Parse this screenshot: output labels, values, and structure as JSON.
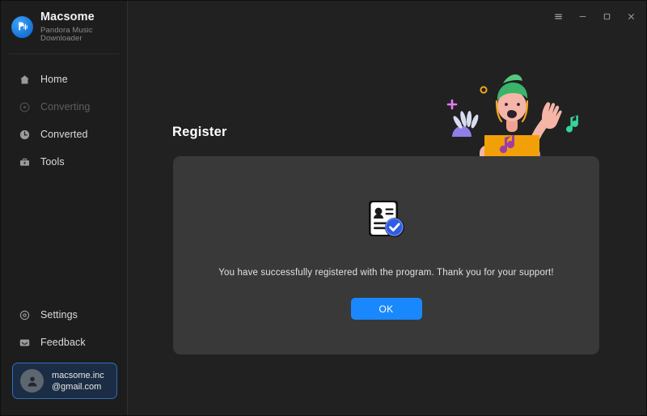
{
  "window": {
    "controls": [
      {
        "name": "menu",
        "icon": "hamburger-menu-icon",
        "label": "☰"
      },
      {
        "name": "minimize",
        "icon": "minimize-icon",
        "label": "─"
      },
      {
        "name": "maximize",
        "icon": "maximize-icon",
        "label": "☐"
      },
      {
        "name": "close",
        "icon": "close-icon",
        "label": "✕"
      }
    ]
  },
  "brand": {
    "title": "Macsome",
    "subtitle": "Pandora Music Downloader",
    "logo_icon": "macsome-logo-icon",
    "logo_color": "#1a88fd"
  },
  "sidebar": {
    "items": [
      {
        "label": "Home",
        "icon": "home-icon",
        "state": "active"
      },
      {
        "label": "Converting",
        "icon": "converting-icon",
        "state": "disabled"
      },
      {
        "label": "Converted",
        "icon": "clock-icon",
        "state": "normal"
      },
      {
        "label": "Tools",
        "icon": "toolbox-icon",
        "state": "normal"
      }
    ],
    "bottom_items": [
      {
        "label": "Settings",
        "icon": "gear-icon"
      },
      {
        "label": "Feedback",
        "icon": "message-icon"
      }
    ],
    "account": {
      "email_line1": "macsome.inc",
      "email_line2": "@gmail.com",
      "avatar_icon": "user-avatar-icon",
      "border_color": "#2f6fb5",
      "background_color": "#1b2d45"
    }
  },
  "main": {
    "page_title": "Register",
    "illustration": {
      "name": "person-with-laptop-illustration",
      "colors": {
        "hair": "#3ab36b",
        "shirt": "#8b5cf6",
        "skin": "#f5b5a7",
        "laptop": "#f2a007",
        "note": "#34d399",
        "plus": "#e879f9",
        "ring": "#f0a61e"
      }
    },
    "card": {
      "icon": "registered-certificate-icon",
      "message": "You have successfully registered with the program. Thank you for your support!",
      "ok_label": "OK",
      "ok_color": "#1a88fd",
      "background_color": "#393939"
    }
  }
}
